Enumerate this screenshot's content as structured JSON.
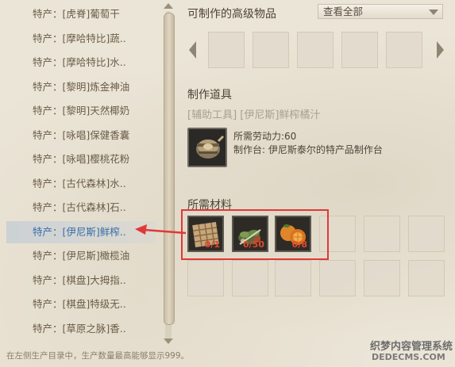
{
  "recipe_list": [
    "特产：[虎脊]葡萄干",
    "特产：[摩哈特比]蔬..",
    "特产：[摩哈特比]水..",
    "特产：[黎明]炼金神油",
    "特产：[黎明]天然椰奶",
    "特产：[咏唱]保健香囊",
    "特产：[咏唱]樱桃花粉",
    "特产：[古代森林]水..",
    "特产：[古代森林]石..",
    "特产：[伊尼斯]鲜榨..",
    "特产：[伊尼斯]橄榄油",
    "特产：[棋盘]大拇指..",
    "特产：[棋盘]特级无..",
    "特产：[草原之脉]香.."
  ],
  "selected_index": 9,
  "advanced": {
    "title": "可制作的高级物品",
    "filter_value": "查看全部"
  },
  "tool": {
    "section_title": "制作道具",
    "name": "[辅助工具] [伊尼斯]鲜榨橘汁",
    "labor": "所需劳动力:60",
    "bench": "制作台: 伊尼斯泰尔的特产品制作台"
  },
  "materials": {
    "section_title": "所需材料",
    "items": [
      {
        "icon": "wood-crate-icon",
        "count": "0/1"
      },
      {
        "icon": "herb-bundle-icon",
        "count": "0/50"
      },
      {
        "icon": "orange-fruit-icon",
        "count": "0/8"
      }
    ]
  },
  "status_text": "在左侧生产目录中，生产数量最高能够显示999。",
  "watermark": {
    "line1": "织梦内容管理系统",
    "line2": "DEDECMS.COM"
  },
  "colors": {
    "highlight": "#e03838",
    "selected_text": "#3a6ea8",
    "count_text": "#e0492e"
  }
}
